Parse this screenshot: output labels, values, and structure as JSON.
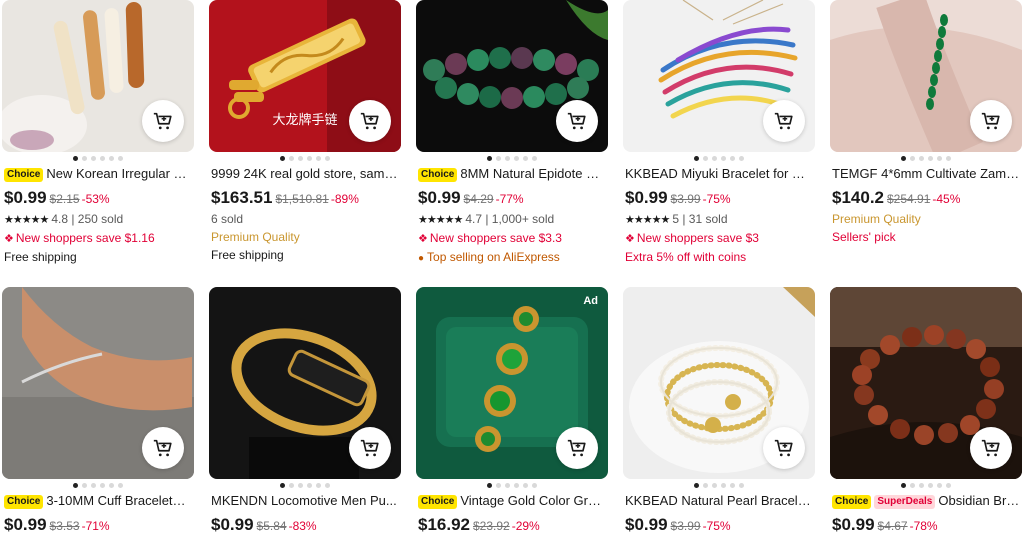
{
  "products_row1": [
    {
      "badge": "Choice",
      "title": "New Korean Irregular Ma...",
      "price": "$0.99",
      "original": "$2.15",
      "discount": "-53%",
      "stars": "★★★★★",
      "rating": "4.8",
      "sold": "250 sold",
      "promo": "New shoppers save $1.16",
      "shipping": "Free shipping"
    },
    {
      "title": "9999 24K real gold store, same ...",
      "price": "$163.51",
      "original": "$1,510.81",
      "discount": "-89%",
      "sold": "6 sold",
      "quality": "Premium Quality",
      "shipping": "Free shipping",
      "image_text": "大龙牌手链"
    },
    {
      "badge": "Choice",
      "title": "8MM Natural Epidote Zoi...",
      "price": "$0.99",
      "original": "$4.29",
      "discount": "-77%",
      "stars": "★★★★★",
      "rating": "4.7",
      "sold": "1,000+ sold",
      "promo": "New shoppers save $3.3",
      "top_selling": "Top selling on AliExpress"
    },
    {
      "title": "KKBEAD Miyuki Bracelet for W...",
      "price": "$0.99",
      "original": "$3.99",
      "discount": "-75%",
      "stars": "★★★★★",
      "rating": "5",
      "sold": "31 sold",
      "promo": "New shoppers save $3",
      "extra": "Extra 5% off with coins"
    },
    {
      "title": "TEMGF 4*6mm Cultivate Zamb...",
      "price": "$140.2",
      "original": "$254.91",
      "discount": "-45%",
      "quality": "Premium Quality",
      "pick": "Sellers' pick"
    }
  ],
  "products_row2": [
    {
      "badge": "Choice",
      "title": "3-10MM Cuff Bracelets f...",
      "price": "$0.99",
      "original": "$3.53",
      "discount": "-71%"
    },
    {
      "title": "MKENDN Locomotive Men Pu...",
      "price": "$0.99",
      "original": "$5.84",
      "discount": "-83%"
    },
    {
      "badge": "Choice",
      "title": "Vintage Gold Color Gree...",
      "price": "$16.92",
      "original": "$23.92",
      "discount": "-29%",
      "ad": "Ad"
    },
    {
      "title": "KKBEAD Natural Pearl Bracelet...",
      "price": "$0.99",
      "original": "$3.99",
      "discount": "-75%"
    },
    {
      "badge": "Choice",
      "badge2": "SuperDeals",
      "title": "Obsidian Bracel...",
      "price": "$0.99",
      "original": "$4.67",
      "discount": "-78%"
    }
  ],
  "icons": {
    "cart": "add-to-cart-icon",
    "flame": "flame-icon",
    "pin": "location-pin-icon"
  },
  "colors": {
    "discount": "#e10036",
    "premium": "#c9962f",
    "choice_badge": "#ffe500",
    "top_selling": "#c05800"
  }
}
